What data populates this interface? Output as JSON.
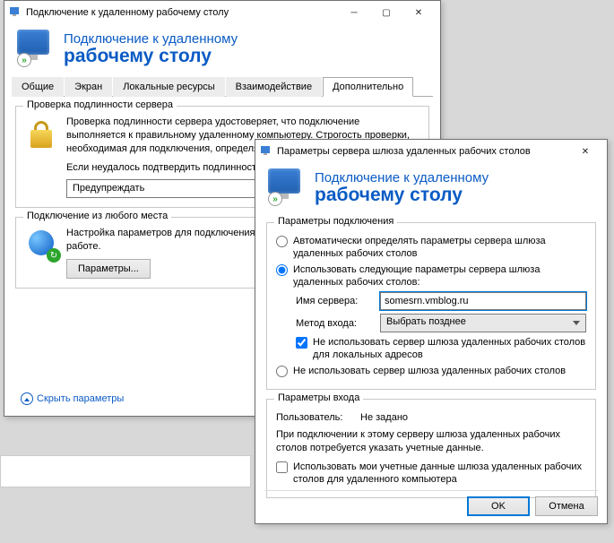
{
  "win1": {
    "title": "Подключение к удаленному рабочему столу",
    "banner": {
      "line1": "Подключение к удаленному",
      "line2": "рабочему столу"
    },
    "tabs": [
      "Общие",
      "Экран",
      "Локальные ресурсы",
      "Взаимодействие",
      "Дополнительно"
    ],
    "active_tab": 4,
    "group_auth": {
      "legend": "Проверка подлинности сервера",
      "para1": "Проверка подлинности сервера удостоверяет, что подключение выполняется к правильному удаленному компьютеру. Строгость проверки, необходимая для подключения, определяется политикой безопасности.",
      "para2": "Если неудалось подтвердить подлинность удаленного компьютера:",
      "combo": "Предупреждать"
    },
    "group_anywhere": {
      "legend": "Подключение из любого места",
      "text": "Настройка параметров для подключения через шлюз при удаленной работе.",
      "button": "Параметры..."
    },
    "hide_link": "Скрыть параметры"
  },
  "win2": {
    "title": "Параметры сервера шлюза удаленных рабочих столов",
    "banner": {
      "line1": "Подключение к удаленному",
      "line2": "рабочему столу"
    },
    "group_conn": {
      "legend": "Параметры подключения",
      "radio_auto": "Автоматически определять параметры сервера шлюза удаленных рабочих столов",
      "radio_use": "Использовать следующие параметры сервера шлюза удаленных рабочих столов:",
      "server_label": "Имя сервера:",
      "server_value": "somesrn.vmblog.ru",
      "method_label": "Метод входа:",
      "method_value": "Выбрать позднее",
      "check_bypass": "Не использовать сервер шлюза удаленных рабочих столов для локальных адресов",
      "radio_none": "Не использовать сервер шлюза удаленных рабочих столов"
    },
    "group_login": {
      "legend": "Параметры входа",
      "user_label": "Пользователь:",
      "user_value": "Не задано",
      "info": "При подключении к этому серверу шлюза удаленных рабочих столов потребуется указать учетные данные.",
      "check_cred": "Использовать мои учетные данные шлюза удаленных рабочих столов для удаленного компьютера"
    },
    "ok": "OK",
    "cancel": "Отмена"
  }
}
